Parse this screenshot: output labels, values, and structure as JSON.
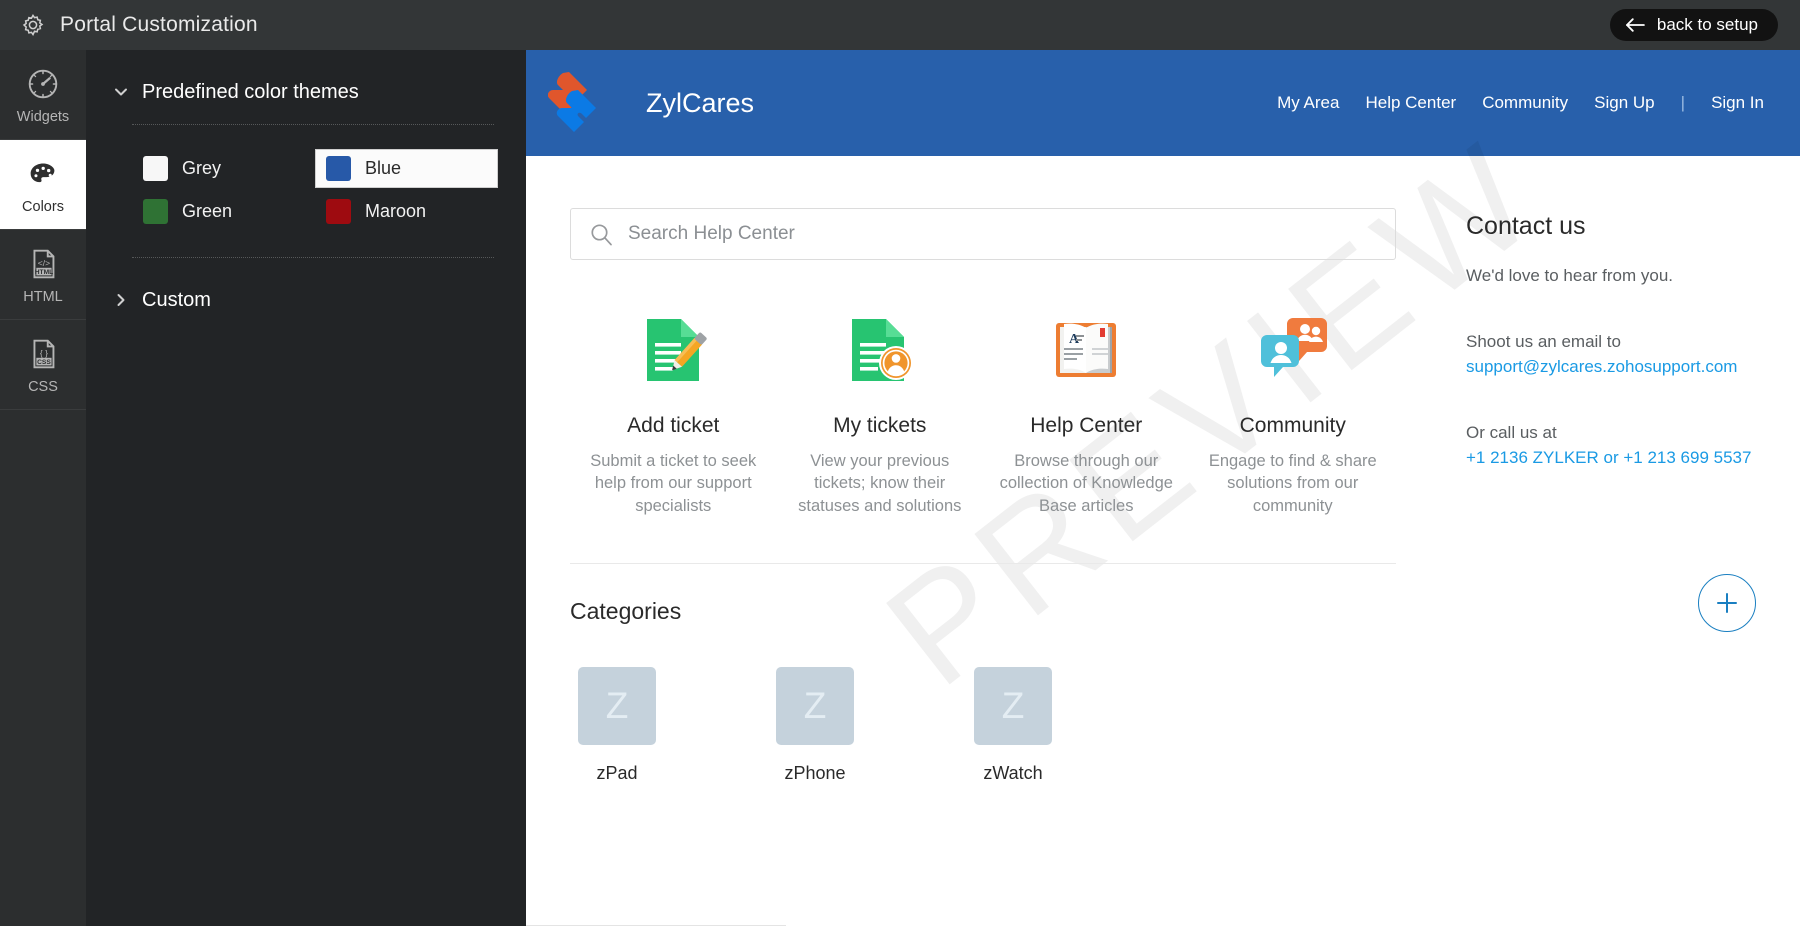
{
  "topbar": {
    "title": "Portal Customization",
    "gear_icon": "gear-icon",
    "back_label": "back to setup",
    "back_icon": "arrow-left-icon"
  },
  "rail": {
    "items": [
      {
        "label": "Widgets",
        "icon": "gauge-icon",
        "active": false
      },
      {
        "label": "Colors",
        "icon": "palette-icon",
        "active": true
      },
      {
        "label": "HTML",
        "icon": "html-file-icon",
        "active": false
      },
      {
        "label": "CSS",
        "icon": "css-file-icon",
        "active": false
      }
    ]
  },
  "panel": {
    "predefined": {
      "title": "Predefined color themes",
      "caret_icon": "chevron-down-icon",
      "expanded": true,
      "themes": [
        {
          "label": "Grey",
          "color": "#f7f7f7",
          "selected": false
        },
        {
          "label": "Blue",
          "color": "#2759a8",
          "selected": true
        },
        {
          "label": "Green",
          "color": "#2f7234",
          "selected": false
        },
        {
          "label": "Maroon",
          "color": "#9e0b10",
          "selected": false
        }
      ]
    },
    "custom": {
      "title": "Custom",
      "caret_icon": "chevron-right-icon",
      "expanded": false
    }
  },
  "preview": {
    "watermark": "PREVIEW",
    "header": {
      "brand_name": "ZylCares",
      "logo_icon": "zylker-logo-icon",
      "logo_colors": {
        "orange": "#e0562c",
        "blue": "#0b7ae5"
      },
      "background": "#2860ab",
      "nav": [
        {
          "label": "My Area"
        },
        {
          "label": "Help Center"
        },
        {
          "label": "Community"
        },
        {
          "label": "Sign Up"
        },
        {
          "label": "Sign In"
        }
      ],
      "nav_separator": "|"
    },
    "search": {
      "placeholder": "Search Help Center",
      "value": "",
      "icon": "search-icon"
    },
    "features": [
      {
        "title": "Add ticket",
        "desc": "Submit a ticket to seek help from our support specialists",
        "icon": "document-pencil-icon"
      },
      {
        "title": "My tickets",
        "desc": "View your previous tickets; know their statuses and solutions",
        "icon": "document-user-icon"
      },
      {
        "title": "Help Center",
        "desc": "Browse through our collection of Knowledge Base articles",
        "icon": "open-book-icon"
      },
      {
        "title": "Community",
        "desc": "Engage to find & share solutions from our community",
        "icon": "chat-bubbles-icon"
      }
    ],
    "categories": {
      "title": "Categories",
      "items": [
        {
          "label": "zPad",
          "thumb_letter": "Z"
        },
        {
          "label": "zPhone",
          "thumb_letter": "Z"
        },
        {
          "label": "zWatch",
          "thumb_letter": "Z"
        }
      ]
    },
    "contact": {
      "title": "Contact us",
      "line1": "We'd love to hear from you.",
      "line2": "Shoot us an email to",
      "email": "support@zylcares.zohosupport.com",
      "line3": "Or call us at",
      "phone": "+1 2136 ZYLKER or +1 213 699 5537",
      "link_color": "#1a9ae4"
    },
    "fab": {
      "icon": "plus-icon",
      "color": "#1a7fc1"
    }
  }
}
